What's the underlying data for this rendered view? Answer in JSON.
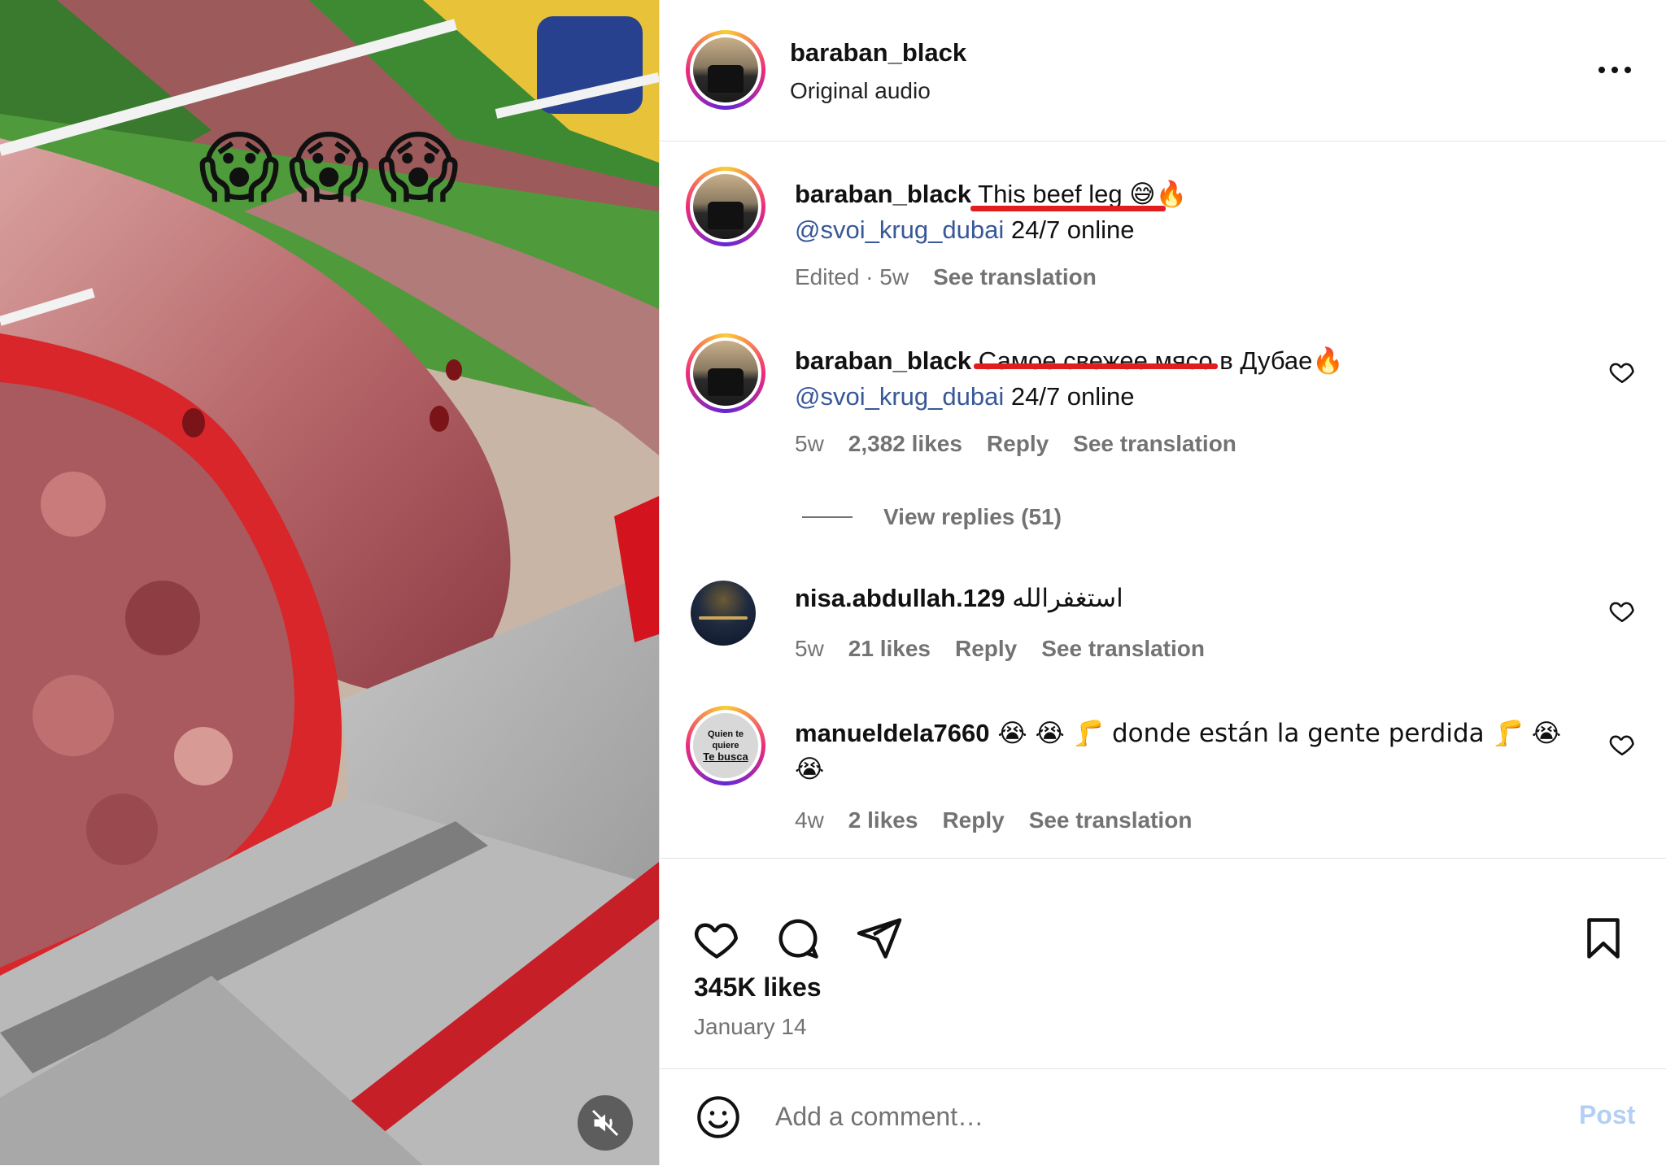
{
  "media": {
    "overlay_emojis": [
      "😱",
      "😱",
      "😱"
    ],
    "mute_icon": "speaker-muted-icon"
  },
  "header": {
    "username": "baraban_black",
    "audio_label": "Original audio",
    "more_icon": "more-options-icon"
  },
  "caption": {
    "username": "baraban_black",
    "text": " This beef leg",
    "emojis": "😅🔥",
    "mention": "@svoi_krug_dubai",
    "mention_suffix": " 24/7 online",
    "edited_label": "Edited · 5w",
    "see_translation": "See translation"
  },
  "comments": [
    {
      "username": "baraban_black",
      "text": " Самое свежее мясо в Дубае",
      "emojis": "🔥",
      "mention": "@svoi_krug_dubai",
      "mention_suffix": " 24/7 online",
      "time": "5w",
      "likes": "2,382 likes",
      "reply": "Reply",
      "see_translation": "See translation",
      "view_replies": "View replies (51)"
    },
    {
      "username": "nisa.abdullah.129",
      "text": " استغفرالله",
      "time": "5w",
      "likes": "21 likes",
      "reply": "Reply",
      "see_translation": "See translation"
    },
    {
      "username": "manueldela7660",
      "text_part1": " 😭 😭 🦵 donde están la gente perdida 🦵 😭",
      "text_part2": "😭",
      "avatar_text_1": "Quien te",
      "avatar_text_2": "quiere",
      "avatar_text_3": "Te busca",
      "time": "4w",
      "likes": "2 likes",
      "reply": "Reply",
      "see_translation": "See translation"
    }
  ],
  "actions": {
    "like_icon": "heart-icon",
    "comment_icon": "comment-icon",
    "share_icon": "share-icon",
    "save_icon": "bookmark-icon",
    "likes_count": "345K likes",
    "date": "January 14"
  },
  "comment_bar": {
    "emoji_icon": "emoji-icon",
    "placeholder": "Add a comment…",
    "post_label": "Post"
  },
  "colors": {
    "mention": "#385898",
    "meta_gray": "#737373",
    "post_disabled": "#b3cff5",
    "annotation_red": "#e11d1d"
  }
}
